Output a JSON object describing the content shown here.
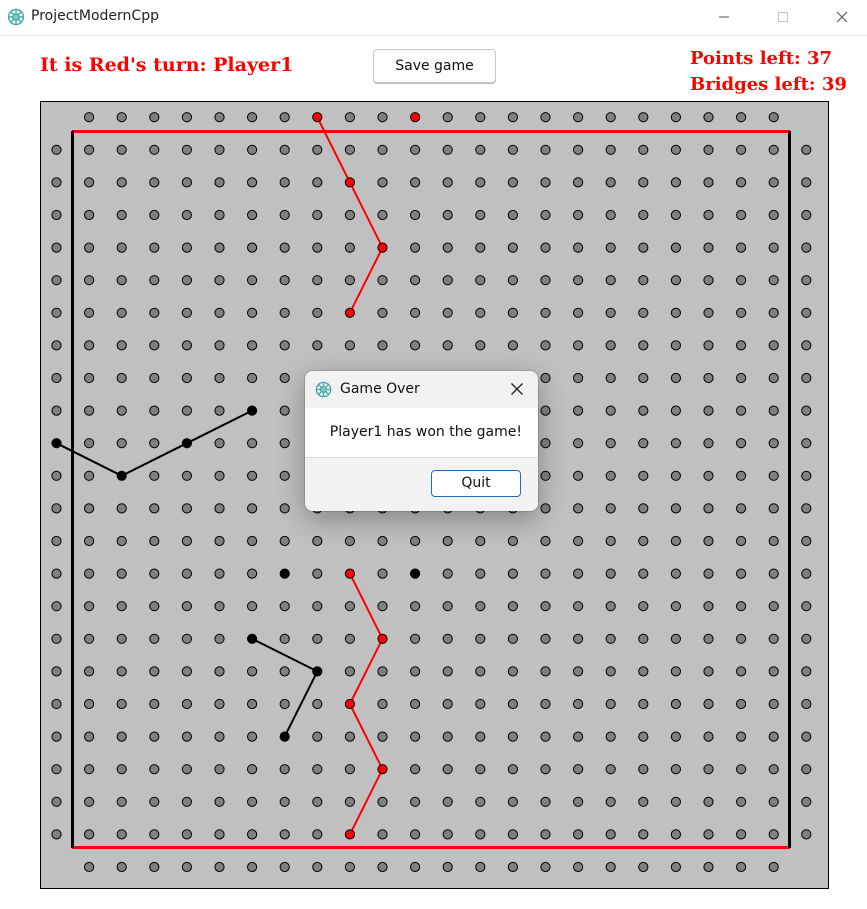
{
  "window": {
    "title": "ProjectModernCpp",
    "minimize_icon": "minimize-icon",
    "maximize_icon": "maximize-icon",
    "close_icon": "close-icon"
  },
  "header": {
    "turn_text": "It is Red's turn: Player1",
    "save_button": "Save game",
    "points_left": "Points left: 37",
    "bridges_left": "Bridges left: 39",
    "accent_color": "#ff0000"
  },
  "board": {
    "size": 24,
    "background": "#c0c0c0",
    "empty_color": "#808080",
    "red_color": "#ff0000",
    "black_color": "#000000",
    "red_pegs": [
      [
        0,
        8
      ],
      [
        0,
        11
      ],
      [
        2,
        9
      ],
      [
        4,
        10
      ],
      [
        6,
        9
      ],
      [
        14,
        9
      ],
      [
        16,
        10
      ],
      [
        18,
        9
      ],
      [
        20,
        10
      ],
      [
        22,
        9
      ]
    ],
    "black_pegs": [
      [
        9,
        6
      ],
      [
        10,
        0
      ],
      [
        10,
        4
      ],
      [
        11,
        2
      ],
      [
        14,
        7
      ],
      [
        14,
        11
      ],
      [
        16,
        6
      ],
      [
        17,
        8
      ],
      [
        19,
        7
      ]
    ],
    "red_bridges": [
      [
        [
          0,
          8
        ],
        [
          2,
          9
        ]
      ],
      [
        [
          2,
          9
        ],
        [
          4,
          10
        ]
      ],
      [
        [
          4,
          10
        ],
        [
          6,
          9
        ]
      ],
      [
        [
          14,
          9
        ],
        [
          16,
          10
        ]
      ],
      [
        [
          16,
          10
        ],
        [
          18,
          9
        ]
      ],
      [
        [
          18,
          9
        ],
        [
          20,
          10
        ]
      ],
      [
        [
          20,
          10
        ],
        [
          22,
          9
        ]
      ]
    ],
    "black_bridges": [
      [
        [
          10,
          0
        ],
        [
          11,
          2
        ]
      ],
      [
        [
          11,
          2
        ],
        [
          10,
          4
        ]
      ],
      [
        [
          10,
          4
        ],
        [
          9,
          6
        ]
      ],
      [
        [
          16,
          6
        ],
        [
          17,
          8
        ]
      ],
      [
        [
          17,
          8
        ],
        [
          19,
          7
        ]
      ]
    ]
  },
  "dialog": {
    "title": "Game Over",
    "message": "Player1 has won the game!",
    "quit_button": "Quit",
    "close_icon": "close-icon"
  }
}
